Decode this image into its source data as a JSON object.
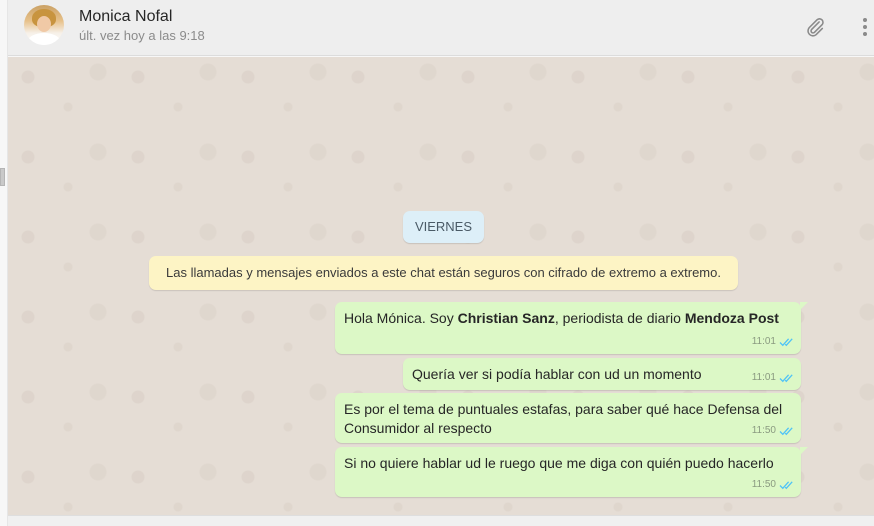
{
  "header": {
    "contact_name": "Monica Nofal",
    "last_seen": "últ. vez hoy a las 9:18",
    "attach_icon": "paperclip-icon",
    "menu_icon": "vertical-dots-icon"
  },
  "chat": {
    "date_divider": "VIERNES",
    "encryption_notice": "Las llamadas y mensajes enviados a este chat están seguros con cifrado de extremo a extremo.",
    "messages": [
      {
        "parts": [
          "Hola Mónica. Soy ",
          "Christian Sanz",
          ", periodista de diario ",
          "Mendoza Post"
        ],
        "time": "11:01"
      },
      {
        "text": "Quería ver si podía hablar con ud un momento",
        "time": "11:01"
      },
      {
        "text": "Es por el tema de puntuales estafas, para saber qué hace Defensa del Consumidor al respecto",
        "time": "11:50"
      },
      {
        "text": "Si no quiere hablar ud le ruego que me diga con quién puedo hacerlo",
        "time": "11:50"
      }
    ]
  },
  "colors": {
    "outgoing_bubble": "#dcf8c6",
    "chat_background": "#e5ddd5",
    "read_ticks": "#4fc3f7",
    "date_pill": "#ddeff8",
    "notice": "#fdf4c5"
  }
}
